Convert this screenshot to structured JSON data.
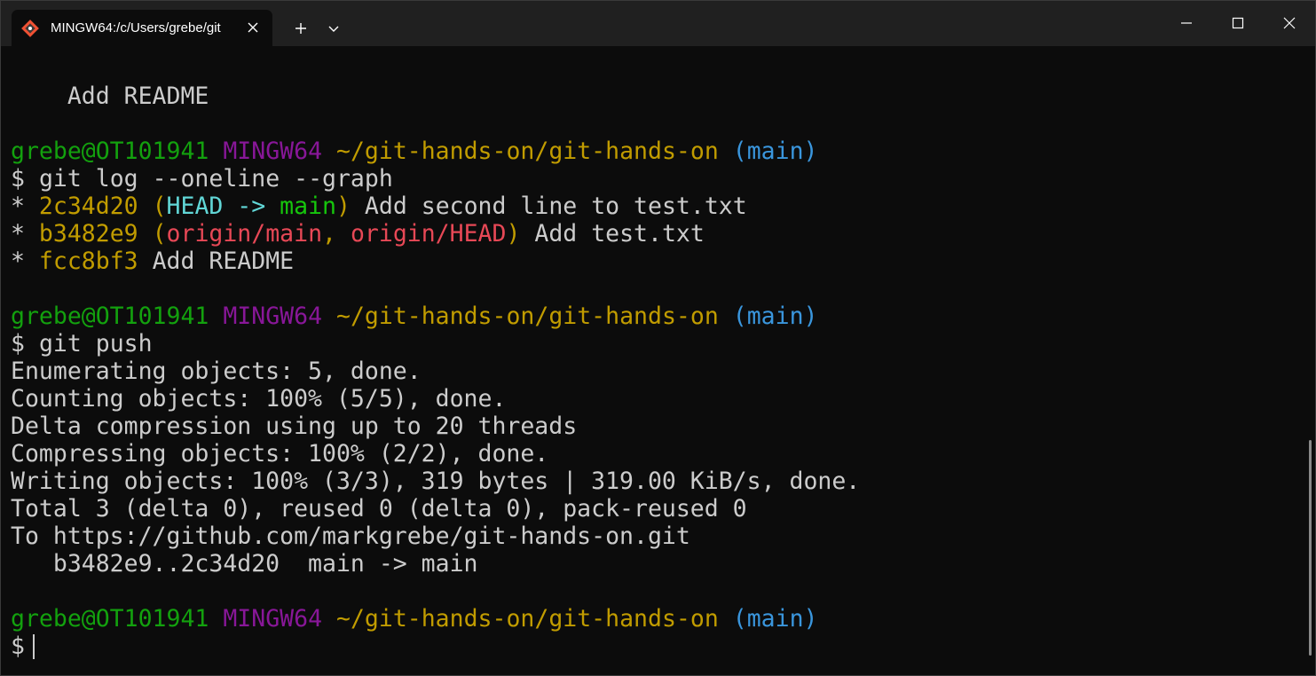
{
  "window": {
    "tab_title": "MINGW64:/c/Users/grebe/git",
    "icons": {
      "app": "git-bash-icon",
      "close_tab": "close-icon",
      "new_tab": "plus-icon",
      "dropdown": "chevron-down-icon",
      "minimize": "minimize-icon",
      "maximize": "maximize-icon",
      "close": "close-icon"
    }
  },
  "terminal": {
    "line0": "    Add README",
    "prompt": {
      "user": "grebe@OT101941",
      "shell": "MINGW64",
      "path": "~/git-hands-on/git-hands-on",
      "branch": "(main)",
      "symbol": "$"
    },
    "cmd1": "git log --oneline --graph",
    "log": [
      {
        "star": "* ",
        "hash": "2c34d20",
        "open": " (",
        "ref1": "HEAD -> ",
        "ref2": "main",
        "close": ")",
        "msg": " Add second line to test.txt"
      },
      {
        "star": "* ",
        "hash": "b3482e9",
        "open": " (",
        "ref1": "origin/main",
        "sep": ", ",
        "ref2": "origin/HEAD",
        "close": ")",
        "msg": " Add test.txt"
      },
      {
        "star": "* ",
        "hash": "fcc8bf3",
        "msg": " Add README"
      }
    ],
    "cmd2": "git push",
    "push_output": [
      "Enumerating objects: 5, done.",
      "Counting objects: 100% (5/5), done.",
      "Delta compression using up to 20 threads",
      "Compressing objects: 100% (2/2), done.",
      "Writing objects: 100% (3/3), 319 bytes | 319.00 KiB/s, done.",
      "Total 3 (delta 0), reused 0 (delta 0), pack-reused 0",
      "To https://github.com/markgrebe/git-hands-on.git",
      "   b3482e9..2c34d20  main -> main"
    ]
  }
}
